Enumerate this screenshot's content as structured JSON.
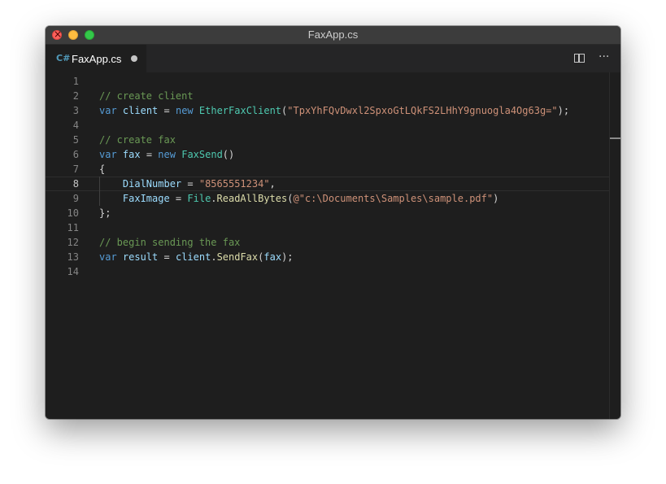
{
  "window": {
    "title": "FaxApp.cs"
  },
  "tab": {
    "icon": "csharp-file-icon",
    "icon_glyph": "C#",
    "label": "FaxApp.cs"
  },
  "toolbar": {
    "split_icon": "split-editor-icon",
    "more_icon": "more-actions-icon",
    "more_glyph": "···"
  },
  "editor": {
    "current_line": 8,
    "lines": [
      {
        "n": "1",
        "tokens": []
      },
      {
        "n": "2",
        "tokens": [
          [
            "c-comment",
            "// create client"
          ]
        ]
      },
      {
        "n": "3",
        "tokens": [
          [
            "c-kw",
            "var"
          ],
          [
            "c-plain",
            " "
          ],
          [
            "c-var",
            "client"
          ],
          [
            "c-plain",
            " = "
          ],
          [
            "c-kw",
            "new"
          ],
          [
            "c-plain",
            " "
          ],
          [
            "c-type",
            "EtherFaxClient"
          ],
          [
            "c-plain",
            "("
          ],
          [
            "c-str",
            "\"TpxYhFQvDwxl2SpxoGtLQkFS2LHhY9gnuogla4Og63g=\""
          ],
          [
            "c-plain",
            ");"
          ]
        ]
      },
      {
        "n": "4",
        "tokens": []
      },
      {
        "n": "5",
        "tokens": [
          [
            "c-comment",
            "// create fax"
          ]
        ]
      },
      {
        "n": "6",
        "tokens": [
          [
            "c-kw",
            "var"
          ],
          [
            "c-plain",
            " "
          ],
          [
            "c-var",
            "fax"
          ],
          [
            "c-plain",
            " = "
          ],
          [
            "c-kw",
            "new"
          ],
          [
            "c-plain",
            " "
          ],
          [
            "c-type",
            "FaxSend"
          ],
          [
            "c-plain",
            "()"
          ]
        ]
      },
      {
        "n": "7",
        "tokens": [
          [
            "c-plain",
            "{"
          ]
        ]
      },
      {
        "n": "8",
        "tokens": [
          [
            "c-plain",
            "    "
          ],
          [
            "c-var",
            "DialNumber"
          ],
          [
            "c-plain",
            " = "
          ],
          [
            "c-str",
            "\"8565551234\""
          ],
          [
            "c-plain",
            ","
          ]
        ]
      },
      {
        "n": "9",
        "tokens": [
          [
            "c-plain",
            "    "
          ],
          [
            "c-var",
            "FaxImage"
          ],
          [
            "c-plain",
            " = "
          ],
          [
            "c-type",
            "File"
          ],
          [
            "c-plain",
            "."
          ],
          [
            "c-fn",
            "ReadAllBytes"
          ],
          [
            "c-plain",
            "("
          ],
          [
            "c-str",
            "@\"c:\\Documents\\Samples\\sample.pdf\""
          ],
          [
            "c-plain",
            ")"
          ]
        ]
      },
      {
        "n": "10",
        "tokens": [
          [
            "c-plain",
            "};"
          ]
        ]
      },
      {
        "n": "11",
        "tokens": []
      },
      {
        "n": "12",
        "tokens": [
          [
            "c-comment",
            "// begin sending the fax"
          ]
        ]
      },
      {
        "n": "13",
        "tokens": [
          [
            "c-kw",
            "var"
          ],
          [
            "c-plain",
            " "
          ],
          [
            "c-var",
            "result"
          ],
          [
            "c-plain",
            " = "
          ],
          [
            "c-var",
            "client"
          ],
          [
            "c-plain",
            "."
          ],
          [
            "c-fn",
            "SendFax"
          ],
          [
            "c-plain",
            "("
          ],
          [
            "c-var",
            "fax"
          ],
          [
            "c-plain",
            ");"
          ]
        ]
      },
      {
        "n": "14",
        "tokens": []
      }
    ]
  }
}
